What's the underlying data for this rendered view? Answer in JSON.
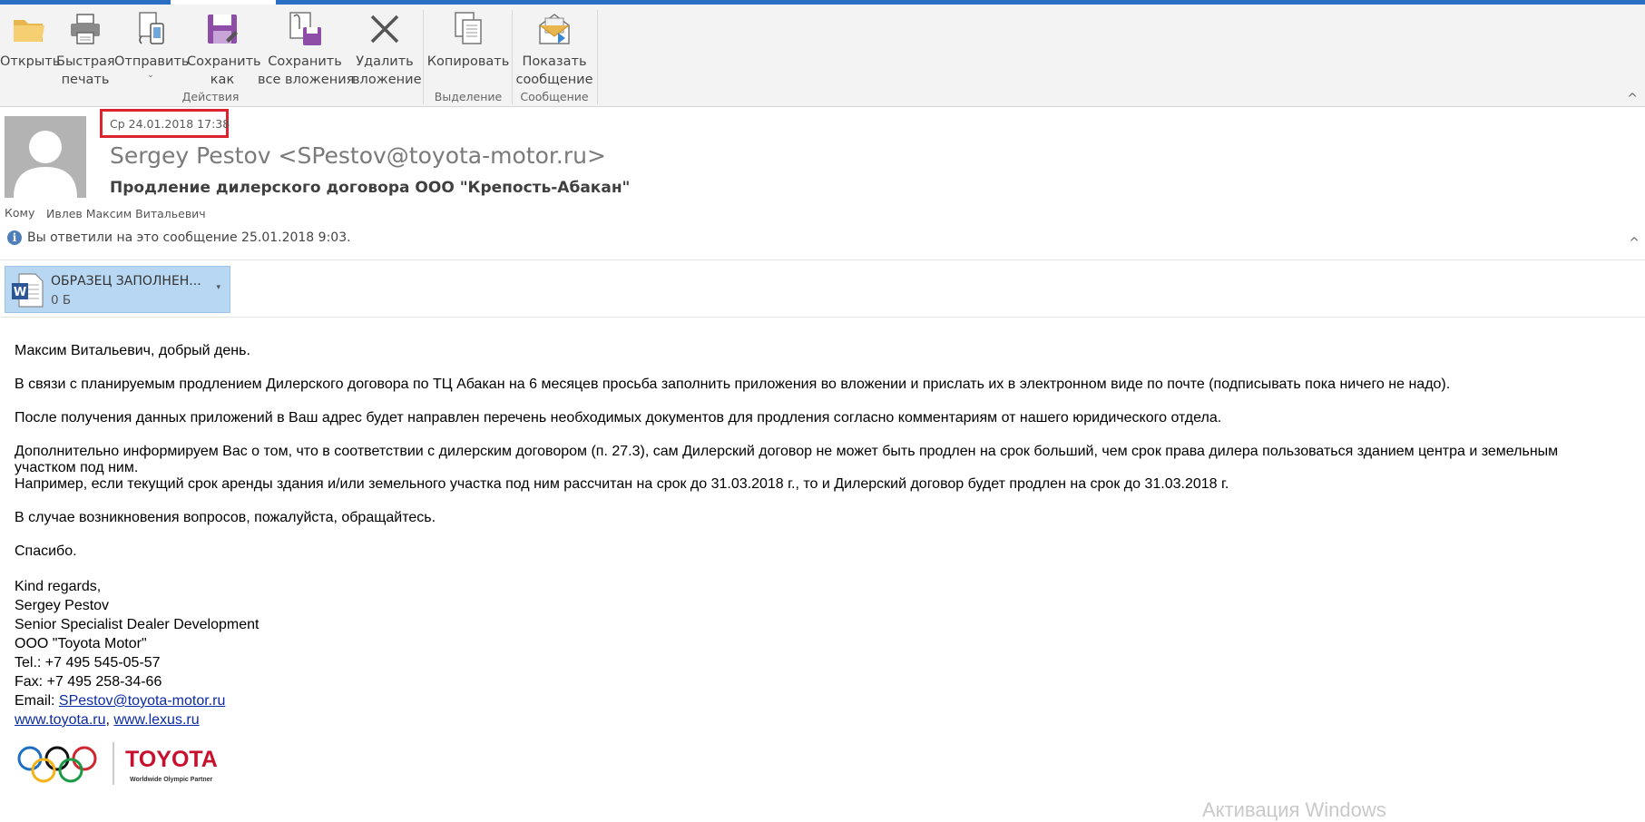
{
  "ribbon": {
    "buttons": [
      {
        "id": "open",
        "label": "Открыть",
        "icon": "folder-icon"
      },
      {
        "id": "quick-print",
        "label": "Быстрая\nпечать",
        "icon": "printer-icon"
      },
      {
        "id": "send",
        "label": "Отправить",
        "icon": "send-to-icon",
        "dropdown": "⌄"
      },
      {
        "id": "save-as",
        "label": "Сохранить\nкак",
        "icon": "save-icon"
      },
      {
        "id": "save-all",
        "label": "Сохранить\nвсе вложения",
        "icon": "save-all-attachments-icon"
      },
      {
        "id": "remove",
        "label": "Удалить\nвложение",
        "icon": "remove-attachment-icon"
      },
      {
        "id": "copy",
        "label": "Копировать",
        "icon": "copy-icon"
      },
      {
        "id": "show",
        "label": "Показать\nсообщение",
        "icon": "show-message-icon"
      }
    ],
    "groups": {
      "actions": "Действия",
      "selection": "Выделение",
      "message": "Сообщение"
    },
    "collapse_glyph": "^"
  },
  "header": {
    "date": "Ср 24.01.2018 17:38",
    "sender": "Sergey Pestov <SPestov@toyota-motor.ru>",
    "subject": "Продление дилерского договора ООО \"Крепость-Абакан\"",
    "to_label": "Кому",
    "to_value": "Ивлев Максим Витальевич",
    "info": "Вы ответили на это сообщение 25.01.2018 9:03.",
    "info_icon": "info-icon",
    "collapse_glyph": "^"
  },
  "attachment": {
    "name": "ОБРАЗЕЦ ЗАПОЛНЕН...",
    "size": "0 Б",
    "icon": "word-document-icon",
    "caret": "▾"
  },
  "body": {
    "greeting": "Максим Витальевич, добрый день.",
    "p1": "В связи с планируемым продлением Дилерского договора по ТЦ Абакан на 6 месяцев просьба заполнить приложения во вложении и прислать их в электронном виде по почте (подписывать пока ничего не надо).",
    "p2": "После получения данных приложений в Ваш адрес будет направлен перечень необходимых документов для продления согласно комментариям от нашего юридического отдела.",
    "p3a": "Дополнительно информируем Вас о том, что в соответствии с дилерским договором (п. 27.3), сам Дилерский договор не может быть продлен на срок больший, чем срок права дилера пользоваться зданием центра и земельным участком под ним.",
    "p3b": "Например, если текущий срок аренды здания и/или земельного участка под ним рассчитан на срок до 31.03.2018 г., то и Дилерский договор будет продлен на срок до 31.03.2018 г.",
    "p4": "В случае возникновения вопросов, пожалуйста, обращайтесь.",
    "thanks": "Спасибо.",
    "signature": {
      "regards": "Kind regards,",
      "name": "Sergey Pestov",
      "title": "Senior Specialist Dealer Development",
      "company": "ООО \"Toyota Motor\"",
      "tel": "Tel.: +7 495 545-05-57",
      "fax": "Fax: +7 495 258-34-66",
      "email_label": "Email: ",
      "email": "SPestov@toyota-motor.ru",
      "site1": "www.toyota.ru",
      "sep": ", ",
      "site2": "www.lexus.ru"
    }
  },
  "logo": {
    "brand": "TOYOTA",
    "tagline": "Worldwide Olympic Partner"
  },
  "watermark": "Активация Windows"
}
